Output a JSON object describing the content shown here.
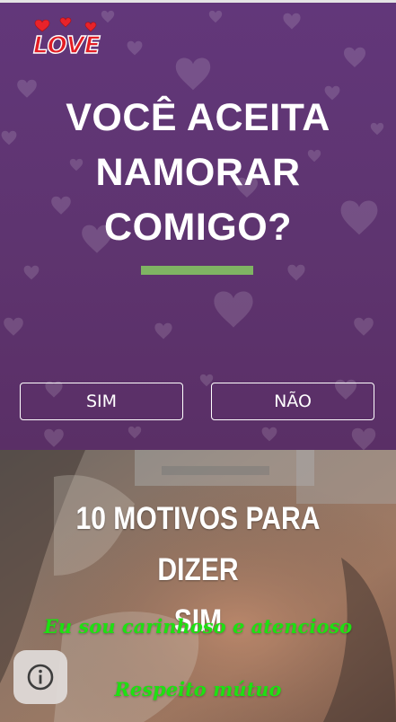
{
  "logo": {
    "text": "LOVE",
    "icon": "love-logo-icon"
  },
  "hero": {
    "headline_lines": [
      "VOCÊ ACEITA",
      "NAMORAR",
      "COMIGO?"
    ],
    "accent_color": "#7fb463",
    "background_color": "#5f3572"
  },
  "buttons": {
    "yes": "SIM",
    "no": "NÃO"
  },
  "reasons": {
    "title_lines": [
      "10 MOTIVOS PARA DIZER",
      "SIM"
    ],
    "items": [
      "Eu sou carinhoso e atencioso",
      "Respeito mútuo"
    ],
    "item_color": "#1ee012"
  },
  "info_button": {
    "icon": "info-icon"
  }
}
